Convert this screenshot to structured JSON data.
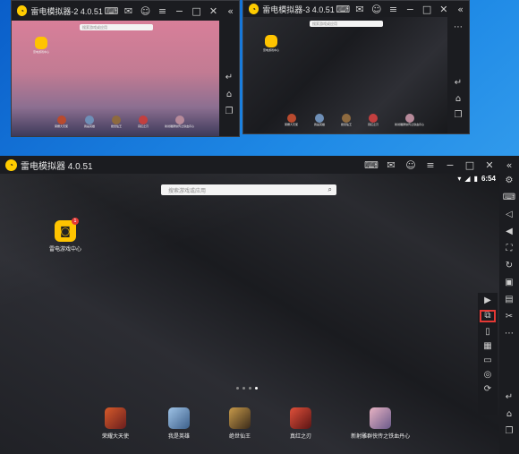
{
  "desktop": {
    "background": "#1e8fe0"
  },
  "window2": {
    "title": "雷电模拟器-2 4.0.51",
    "search_placeholder": "搜索游戏或应用",
    "home_app_label": "雷电游戏中心",
    "apps": [
      "荣耀大天使",
      "我是英雄",
      "绝世仙王",
      "真红之刃",
      "新射雕群侠传之铁血丹心"
    ]
  },
  "window3": {
    "title": "雷电模拟器-3 4.0.51",
    "search_placeholder": "搜索游戏或应用",
    "home_app_label": "雷电游戏中心",
    "apps": [
      "荣耀大天使",
      "我是英雄",
      "绝世仙王",
      "真红之刃",
      "新射雕群侠传之铁血丹心"
    ]
  },
  "main": {
    "title": "雷电模拟器 4.0.51",
    "clock": "6:54",
    "search_placeholder": "搜索游戏或应用",
    "home_app_label": "雷电游戏中心",
    "home_app_badge": "1",
    "apps": [
      "荣耀大天使",
      "我是英雄",
      "绝世仙王",
      "真红之刃",
      "新射雕群侠传之铁血丹心"
    ],
    "page_dots": 4,
    "active_page": 4,
    "highlight_color": "#e53935",
    "sidebar_icons": [
      "settings-icon",
      "keyboard-icon",
      "volume-down-icon",
      "volume-up-icon",
      "fullscreen-icon",
      "rotate-icon",
      "screenshot-icon",
      "apk-icon",
      "cut-icon"
    ],
    "toolbox_icons": [
      "record-icon",
      "multi-window-icon",
      "shake-icon",
      "keymap-icon",
      "folder-icon",
      "location-icon",
      "sync-icon"
    ],
    "nav_icons": [
      "back-icon",
      "home-icon",
      "recent-apps-icon"
    ]
  }
}
